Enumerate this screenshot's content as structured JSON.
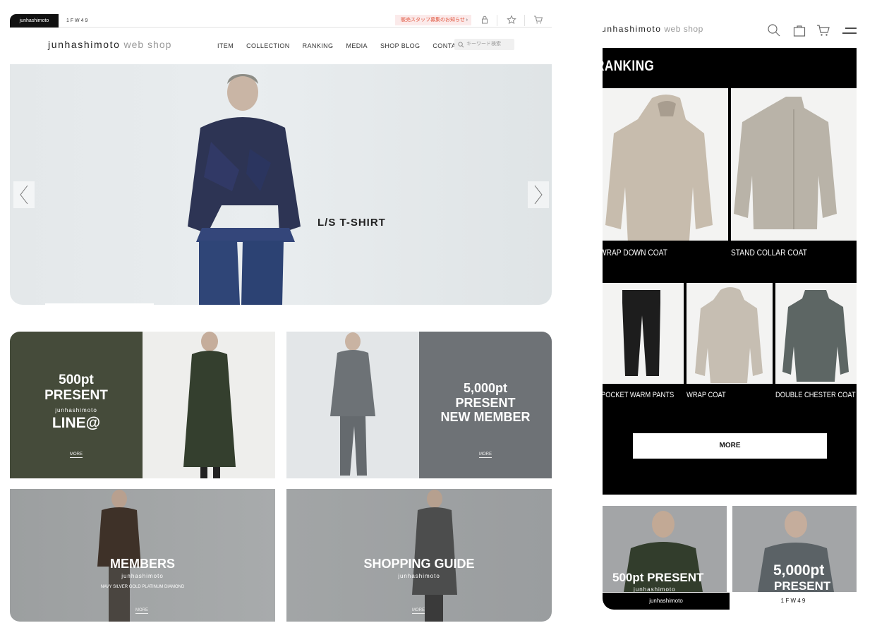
{
  "desktop": {
    "topbar": {
      "tab_active": "junhashimoto",
      "tab_other": "1 F W 4 9",
      "recruit_label": "販売スタッフ募集のお知らせ",
      "recruit_chevron": "›"
    },
    "header": {
      "logo_main": "junhashimoto",
      "logo_sub": "web shop",
      "nav": [
        "ITEM",
        "COLLECTION",
        "RANKING",
        "MEDIA",
        "SHOP BLOG",
        "CONTACT"
      ],
      "search_placeholder": "キーワード検索"
    },
    "hero": {
      "caption": "L/S T-SHIRT",
      "progress": 0.2
    },
    "tiles": {
      "line": {
        "line1": "500pt",
        "line2": "PRESENT",
        "brand": "junhashimoto",
        "line3": "LINE@",
        "more": "MORE"
      },
      "member": {
        "line1": "5,000pt",
        "line2": "PRESENT",
        "line3": "NEW MEMBER",
        "more": "MORE"
      },
      "members": {
        "title": "MEMBERS",
        "brand": "junhashimoto",
        "ranks": "NAVY  SILVER  GOLD  PLATINUM  DIAMOND",
        "more": "MORE"
      },
      "guide": {
        "title": "SHOPPING GUIDE",
        "brand": "junhashimoto",
        "more": "MORE"
      }
    }
  },
  "mobile": {
    "header": {
      "logo_main": "junhashimoto",
      "logo_sub": "web shop"
    },
    "ranking": {
      "title": "RANKING",
      "products": [
        {
          "name": "WRAP DOWN COAT"
        },
        {
          "name": "STAND COLLAR COAT"
        },
        {
          "name": "POCKET WARM PANTS"
        },
        {
          "name": "WRAP COAT"
        },
        {
          "name": "DOUBLE CHESTER COAT"
        }
      ],
      "more": "MORE"
    },
    "banners": {
      "left": {
        "line1": "500pt PRESENT",
        "brand": "junhashimoto"
      },
      "right": {
        "line1": "5,000pt",
        "line2": "PRESENT"
      }
    },
    "footer_tabs": {
      "left": "junhashimoto",
      "right": "1 F W 4 9"
    }
  },
  "colors": {
    "accent_red": "#e0523a",
    "line_tile_green": "#454b3a",
    "member_tile_gray": "#6e7276",
    "black": "#000000"
  }
}
